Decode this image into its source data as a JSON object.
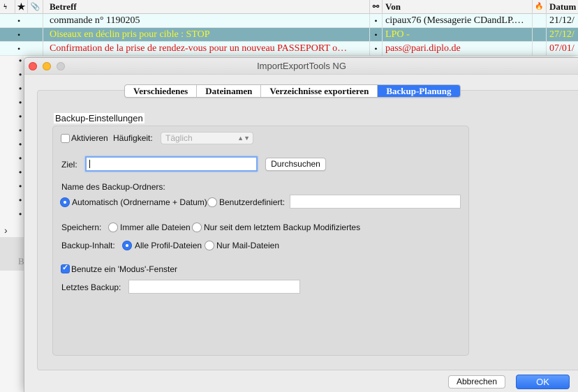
{
  "mail_list": {
    "columns": {
      "thread_icon": "ϟ",
      "star_icon": "★",
      "attach_icon": "📎",
      "subject": "Betreff",
      "correspondent_icon": "⚯",
      "from": "Von",
      "junk_icon": "🔥",
      "date": "Datum"
    },
    "rows": [
      {
        "dot": "•",
        "subject": "commande n° 1190205",
        "from": "cipaux76 (Messagerie CDandLP.…",
        "date": "21/12/"
      },
      {
        "dot": "•",
        "subject": "Oiseaux en déclin pris pour cible : STOP",
        "from": "LPO -",
        "date": "27/12/"
      },
      {
        "dot": "•",
        "subject": "Confirmation de la prise de rendez-vous pour un nouveau PASSEPORT o…",
        "from": "pass@pari.diplo.de",
        "date": "07/01/"
      }
    ],
    "row_colors": [
      "#111111",
      "#f6f62b",
      "#e00d0d"
    ],
    "left_dots": [
      "•",
      "•",
      "•",
      "•",
      "•",
      "•",
      "•",
      "•",
      "•",
      "•",
      "•",
      "•"
    ],
    "expander": "›",
    "lower_letter": "B"
  },
  "dialog": {
    "title": "ImportExportTools NG",
    "tabs": [
      {
        "label": "Verschiedenes",
        "active": false
      },
      {
        "label": "Dateinamen",
        "active": false
      },
      {
        "label": "Verzeichnisse exportieren",
        "active": false
      },
      {
        "label": "Backup-Planung",
        "active": true
      }
    ],
    "group_title": "Backup-Einstellungen",
    "enable_label": "Aktivieren",
    "enable_checked": false,
    "frequency_label": "Häufigkeit:",
    "frequency_value": "Täglich",
    "target_label": "Ziel:",
    "target_value": "",
    "browse_label": "Durchsuchen",
    "folder_name_label": "Name des Backup-Ordners:",
    "folder_auto_label": "Automatisch (Ordnername + Datum)",
    "folder_auto_checked": true,
    "folder_custom_label": "Benutzerdefiniert:",
    "folder_custom_value": "",
    "save_label": "Speichern:",
    "save_all_label": "Immer alle Dateien",
    "save_modified_label": "Nur seit dem letztem Backup Modifiziertes",
    "content_label": "Backup-Inhalt:",
    "content_all_label": "Alle Profil-Dateien",
    "content_mail_label": "Nur Mail-Dateien",
    "modal_label": "Benutze ein 'Modus'-Fenster",
    "modal_checked": true,
    "last_backup_label": "Letztes Backup:",
    "last_backup_value": "",
    "cancel_label": "Abbrechen",
    "ok_label": "OK"
  },
  "colors": {
    "accent": "#3478f6",
    "selected_row": "#7fb0b9",
    "row_bg": "#ecfbfb"
  }
}
